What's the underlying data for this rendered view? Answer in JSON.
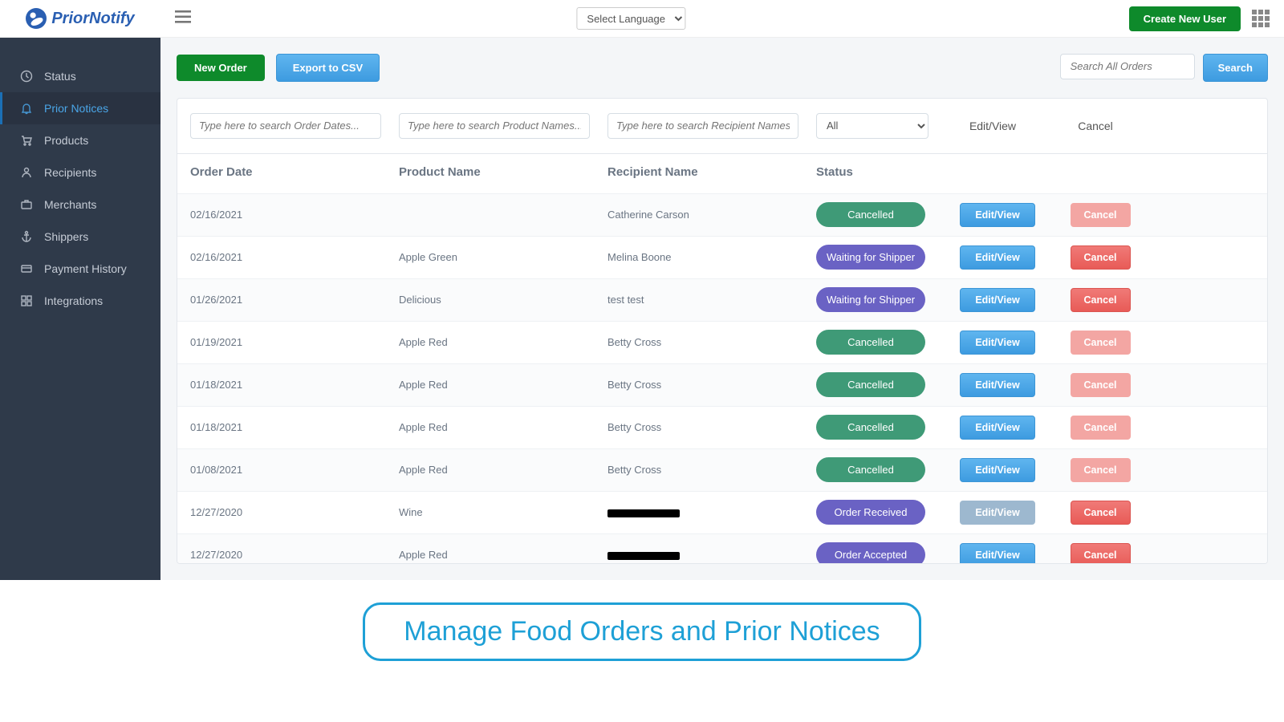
{
  "app": {
    "name": "PriorNotify"
  },
  "topbar": {
    "language_label": "Select Language",
    "create_user": "Create New User"
  },
  "sidebar": {
    "items": [
      {
        "icon": "clock-icon",
        "label": "Status"
      },
      {
        "icon": "bell-icon",
        "label": "Prior Notices",
        "active": true
      },
      {
        "icon": "cart-icon",
        "label": "Products"
      },
      {
        "icon": "person-icon",
        "label": "Recipients"
      },
      {
        "icon": "briefcase-icon",
        "label": "Merchants"
      },
      {
        "icon": "anchor-icon",
        "label": "Shippers"
      },
      {
        "icon": "card-icon",
        "label": "Payment History"
      },
      {
        "icon": "grid-icon",
        "label": "Integrations"
      }
    ]
  },
  "actions": {
    "new_order": "New Order",
    "export_csv": "Export to CSV",
    "search_placeholder": "Search All Orders",
    "search_btn": "Search"
  },
  "table": {
    "filters": {
      "order_date_ph": "Type here to search Order Dates...",
      "product_name_ph": "Type here to search Product Names...",
      "recipient_name_ph": "Type here to search Recipient Names...",
      "status_selected": "All"
    },
    "columns": {
      "order_date": "Order Date",
      "product_name": "Product Name",
      "recipient_name": "Recipient Name",
      "status": "Status",
      "edit_view": "Edit/View",
      "cancel": "Cancel"
    },
    "edit_label": "Edit/View",
    "cancel_label": "Cancel",
    "rows": [
      {
        "date": "02/16/2021",
        "product": "",
        "recipient": "Catherine Carson",
        "status": "Cancelled",
        "status_class": "cancelled",
        "edit_disabled": false,
        "cancel_disabled": true,
        "redacted": false
      },
      {
        "date": "02/16/2021",
        "product": "Apple Green",
        "recipient": "Melina Boone",
        "status": "Waiting for Shipper",
        "status_class": "waiting",
        "edit_disabled": false,
        "cancel_disabled": false,
        "redacted": false
      },
      {
        "date": "01/26/2021",
        "product": "Delicious",
        "recipient": "test test",
        "status": "Waiting for Shipper",
        "status_class": "waiting",
        "edit_disabled": false,
        "cancel_disabled": false,
        "redacted": false
      },
      {
        "date": "01/19/2021",
        "product": "Apple Red",
        "recipient": "Betty Cross",
        "status": "Cancelled",
        "status_class": "cancelled",
        "edit_disabled": false,
        "cancel_disabled": true,
        "redacted": false
      },
      {
        "date": "01/18/2021",
        "product": "Apple Red",
        "recipient": "Betty Cross",
        "status": "Cancelled",
        "status_class": "cancelled",
        "edit_disabled": false,
        "cancel_disabled": true,
        "redacted": false
      },
      {
        "date": "01/18/2021",
        "product": "Apple Red",
        "recipient": "Betty Cross",
        "status": "Cancelled",
        "status_class": "cancelled",
        "edit_disabled": false,
        "cancel_disabled": true,
        "redacted": false
      },
      {
        "date": "01/08/2021",
        "product": "Apple Red",
        "recipient": "Betty Cross",
        "status": "Cancelled",
        "status_class": "cancelled",
        "edit_disabled": false,
        "cancel_disabled": true,
        "redacted": false
      },
      {
        "date": "12/27/2020",
        "product": "Wine",
        "recipient": "",
        "status": "Order Received",
        "status_class": "received",
        "edit_disabled": true,
        "cancel_disabled": false,
        "redacted": true
      },
      {
        "date": "12/27/2020",
        "product": "Apple Red",
        "recipient": "",
        "status": "Order Accepted",
        "status_class": "accepted",
        "edit_disabled": false,
        "cancel_disabled": false,
        "redacted": true
      }
    ]
  },
  "caption": "Manage Food Orders and Prior Notices"
}
